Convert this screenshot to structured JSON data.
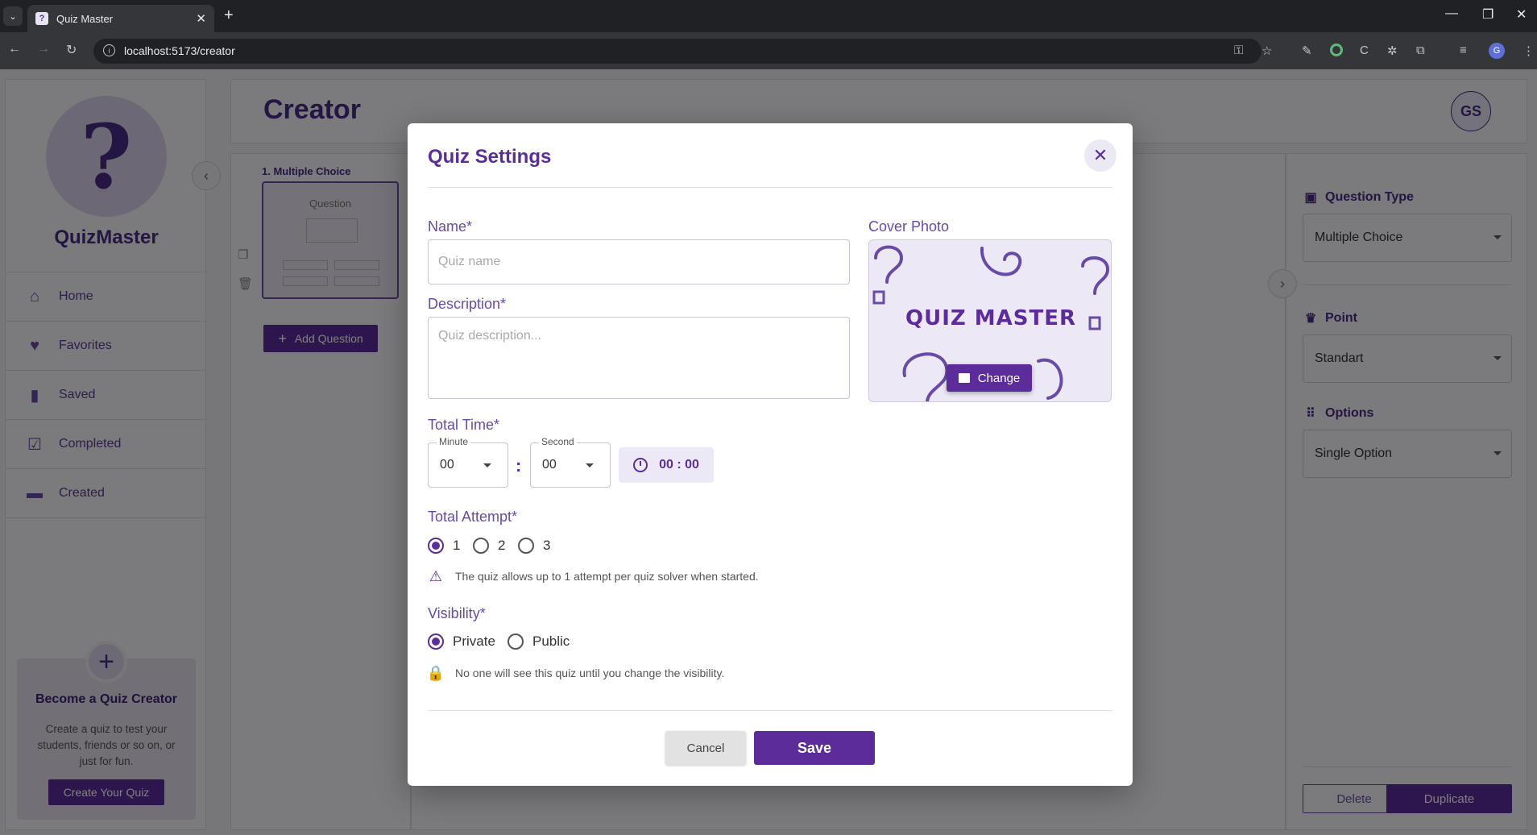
{
  "browser": {
    "tab_title": "Quiz Master",
    "url": "localhost:5173/creator",
    "profile_initial": "G"
  },
  "sidebar": {
    "brand": "QuizMaster",
    "items": [
      {
        "label": "Home",
        "icon": "home-icon"
      },
      {
        "label": "Favorites",
        "icon": "heart-icon"
      },
      {
        "label": "Saved",
        "icon": "bookmark-icon"
      },
      {
        "label": "Completed",
        "icon": "clipboard-check-icon"
      },
      {
        "label": "Created",
        "icon": "folder-icon"
      }
    ],
    "promo": {
      "title": "Become a Quiz Creator",
      "text": "Create a quiz to test your students, friends or so on, or just for fun.",
      "button": "Create Your Quiz"
    }
  },
  "header": {
    "title": "Creator",
    "avatar_initials": "GS"
  },
  "questions": {
    "item_label": "1. Multiple Choice",
    "thumb_text": "Question",
    "add_button": "Add Question"
  },
  "right_panel": {
    "question_type_label": "Question Type",
    "question_type_value": "Multiple Choice",
    "point_label": "Point",
    "point_value": "Standart",
    "options_label": "Options",
    "options_value": "Single Option",
    "delete_button": "Delete",
    "duplicate_button": "Duplicate"
  },
  "modal": {
    "title": "Quiz Settings",
    "name_label": "Name*",
    "name_placeholder": "Quiz name",
    "description_label": "Description*",
    "description_placeholder": "Quiz description...",
    "cover_label": "Cover Photo",
    "cover_logo_text": "QUIZ MASTER",
    "cover_change_button": "Change",
    "total_time_label": "Total Time*",
    "minute_label": "Minute",
    "minute_value": "00",
    "second_label": "Second",
    "second_value": "00",
    "time_colon": ":",
    "timer_display": "00 : 00",
    "total_attempt_label": "Total Attempt*",
    "attempt_options": [
      "1",
      "2",
      "3"
    ],
    "attempt_selected": "1",
    "attempt_hint": "The quiz allows up to 1 attempt per quiz solver when started.",
    "visibility_label": "Visibility*",
    "visibility_options": [
      "Private",
      "Public"
    ],
    "visibility_selected": "Private",
    "visibility_hint": "No one will see this quiz until you change the visibility.",
    "cancel_button": "Cancel",
    "save_button": "Save"
  },
  "colors": {
    "primary": "#5b2c9a",
    "accent_light": "#ece8f6",
    "overlay": "rgba(0,0,0,0.5)"
  }
}
